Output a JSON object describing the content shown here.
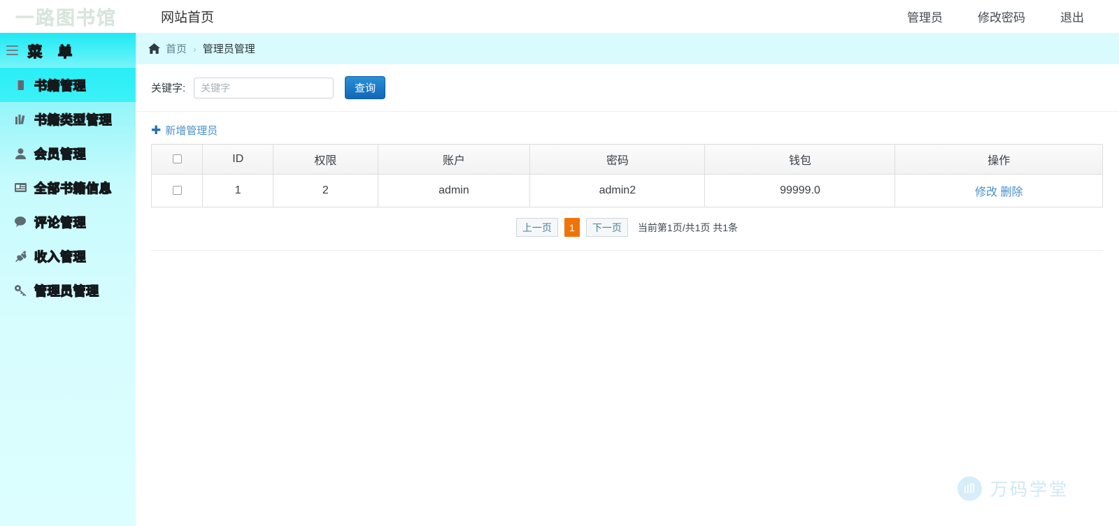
{
  "header": {
    "logo_text": "一路图书馆",
    "home_link": "网站首页",
    "nav_right": [
      {
        "label": "管理员"
      },
      {
        "label": "修改密码"
      },
      {
        "label": "退出"
      }
    ]
  },
  "sidebar": {
    "menu_title": "菜 单",
    "items": [
      {
        "label": "书籍管理",
        "icon": "book-icon",
        "active": true
      },
      {
        "label": "书籍类型管理",
        "icon": "chart-bar-icon",
        "active": false
      },
      {
        "label": "会员管理",
        "icon": "user-icon",
        "active": false
      },
      {
        "label": "全部书籍信息",
        "icon": "id-card-icon",
        "active": false
      },
      {
        "label": "评论管理",
        "icon": "comment-icon",
        "active": false
      },
      {
        "label": "收入管理",
        "icon": "plug-icon",
        "active": false
      },
      {
        "label": "管理员管理",
        "icon": "key-icon",
        "active": false
      }
    ]
  },
  "breadcrumb": {
    "home_icon": "home-icon",
    "home": "首页",
    "separator": "›",
    "current": "管理员管理"
  },
  "filter": {
    "label": "关键字:",
    "input_value": "",
    "input_placeholder": "关键字",
    "query_button": "查询"
  },
  "toolbar": {
    "add_icon": "plus-icon",
    "add_label": "新增管理员"
  },
  "table": {
    "columns": [
      {
        "key": "select",
        "label": ""
      },
      {
        "key": "id",
        "label": "ID"
      },
      {
        "key": "role",
        "label": "权限"
      },
      {
        "key": "account",
        "label": "账户"
      },
      {
        "key": "password",
        "label": "密码"
      },
      {
        "key": "wallet",
        "label": "钱包"
      },
      {
        "key": "actions",
        "label": "操作"
      }
    ],
    "rows": [
      {
        "id": "1",
        "role": "2",
        "account": "admin",
        "password": "admin2",
        "wallet": "99999.0",
        "edit": "修改",
        "delete": "删除"
      }
    ]
  },
  "pagination": {
    "prev": "上一页",
    "current_page": "1",
    "next": "下一页",
    "info": "当前第1页/共1页 共1条"
  },
  "watermark": {
    "text": "万码学堂"
  },
  "colors": {
    "sidebar_top": "#25ecf5",
    "sidebar_bottom": "#dcfeff",
    "active_item": "#2beef6",
    "breadcrumb_bg": "#d9fbfd",
    "primary_button": "#1267b8",
    "link": "#4a90c8",
    "pager_active": "#f0730a",
    "watermark": "#cfe7f7"
  }
}
